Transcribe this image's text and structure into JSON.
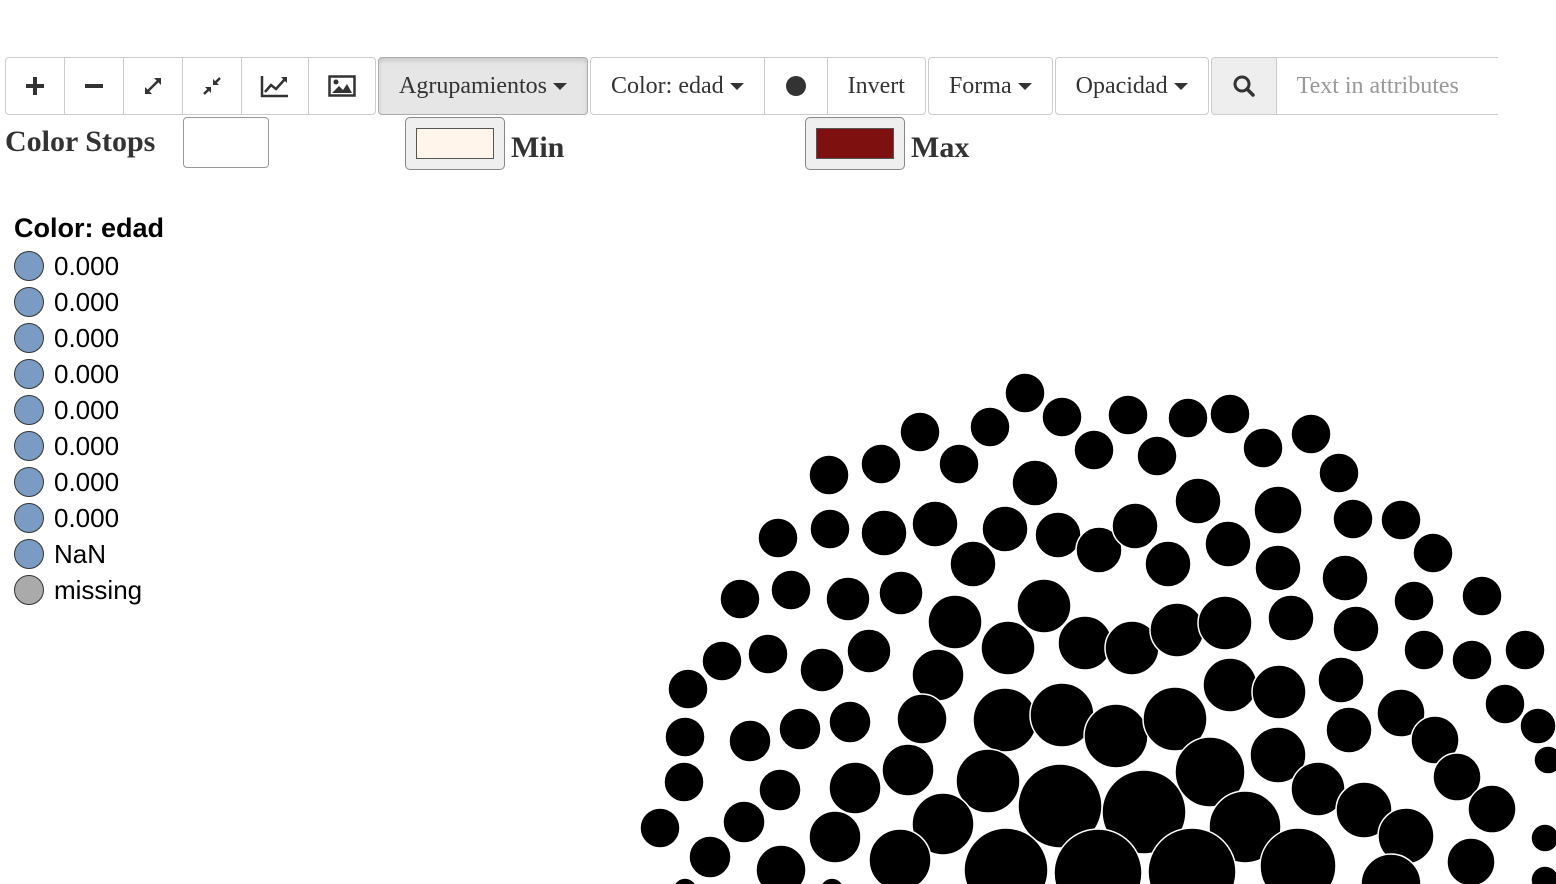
{
  "toolbar": {
    "zoom_in_icon": "plus-icon",
    "zoom_out_icon": "minus-icon",
    "expand_icon": "expand-icon",
    "compress_icon": "compress-icon",
    "chart_icon": "line-chart-icon",
    "image_icon": "image-icon",
    "groupings_label": "Agrupamientos",
    "color_label": "Color: edad",
    "node_shape_icon": "circle-icon",
    "invert_label": "Invert",
    "shape_label": "Forma",
    "opacity_label": "Opacidad",
    "search_icon": "search-icon",
    "search_placeholder": "Text in attributes"
  },
  "color_stops": {
    "label": "Color Stops",
    "stops_value": "",
    "min_label": "Min",
    "min_color": "#fff5eb",
    "max_label": "Max",
    "max_color": "#7f1010"
  },
  "legend": {
    "title": "Color: edad",
    "items": [
      {
        "label": "0.000",
        "color": "#7a9cc4"
      },
      {
        "label": "0.000",
        "color": "#7a9cc4"
      },
      {
        "label": "0.000",
        "color": "#7a9cc4"
      },
      {
        "label": "0.000",
        "color": "#7a9cc4"
      },
      {
        "label": "0.000",
        "color": "#7a9cc4"
      },
      {
        "label": "0.000",
        "color": "#7a9cc4"
      },
      {
        "label": "0.000",
        "color": "#7a9cc4"
      },
      {
        "label": "0.000",
        "color": "#7a9cc4"
      },
      {
        "label": "NaN",
        "color": "#7a9cc4"
      },
      {
        "label": "missing",
        "color": "#aaaaaa"
      }
    ]
  },
  "graph": {
    "node_color": "#000000"
  }
}
